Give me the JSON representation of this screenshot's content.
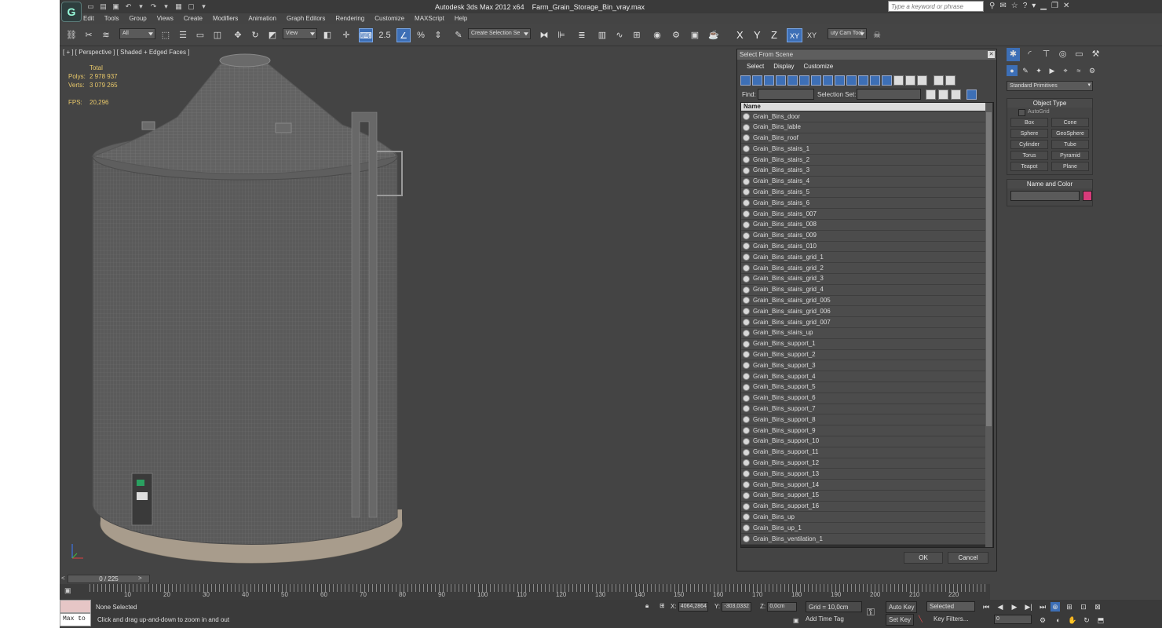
{
  "title": {
    "app": "Autodesk 3ds Max  2012 x64",
    "file": "Farm_Grain_Storage_Bin_vray.max",
    "search_placeholder": "Type a keyword or phrase"
  },
  "menu": [
    "Edit",
    "Tools",
    "Group",
    "Views",
    "Create",
    "Modifiers",
    "Animation",
    "Graph Editors",
    "Rendering",
    "Customize",
    "MAXScript",
    "Help"
  ],
  "toolbar": {
    "filter": "All",
    "refcoord": "View",
    "snap_angle": "2.5",
    "selset": "Create Selection Se",
    "axes": [
      "X",
      "Y",
      "Z",
      "XY",
      "XY"
    ],
    "camtool": "uty Cam Tool"
  },
  "viewport": {
    "label": "[ + ] [ Perspective ] [ Shaded + Edged Faces ]",
    "stats": {
      "total_label": "Total",
      "polys_label": "Polys:",
      "polys": "2 978 937",
      "verts_label": "Verts:",
      "verts": "3 079 265",
      "fps_label": "FPS:",
      "fps": "20,296"
    }
  },
  "sfs": {
    "title": "Select From Scene",
    "menu": [
      "Select",
      "Display",
      "Customize"
    ],
    "find_label": "Find:",
    "selset_label": "Selection Set:",
    "column": "Name",
    "items": [
      "Grain_Bins_door",
      "Grain_Bins_lable",
      "Grain_Bins_roof",
      "Grain_Bins_stairs_1",
      "Grain_Bins_stairs_2",
      "Grain_Bins_stairs_3",
      "Grain_Bins_stairs_4",
      "Grain_Bins_stairs_5",
      "Grain_Bins_stairs_6",
      "Grain_Bins_stairs_007",
      "Grain_Bins_stairs_008",
      "Grain_Bins_stairs_009",
      "Grain_Bins_stairs_010",
      "Grain_Bins_stairs_grid_1",
      "Grain_Bins_stairs_grid_2",
      "Grain_Bins_stairs_grid_3",
      "Grain_Bins_stairs_grid_4",
      "Grain_Bins_stairs_grid_005",
      "Grain_Bins_stairs_grid_006",
      "Grain_Bins_stairs_grid_007",
      "Grain_Bins_stairs_up",
      "Grain_Bins_support_1",
      "Grain_Bins_support_2",
      "Grain_Bins_support_3",
      "Grain_Bins_support_4",
      "Grain_Bins_support_5",
      "Grain_Bins_support_6",
      "Grain_Bins_support_7",
      "Grain_Bins_support_8",
      "Grain_Bins_support_9",
      "Grain_Bins_support_10",
      "Grain_Bins_support_11",
      "Grain_Bins_support_12",
      "Grain_Bins_support_13",
      "Grain_Bins_support_14",
      "Grain_Bins_support_15",
      "Grain_Bins_support_16",
      "Grain_Bins_up",
      "Grain_Bins_up_1",
      "Grain_Bins_ventilation_1"
    ],
    "ok": "OK",
    "cancel": "Cancel"
  },
  "cmd": {
    "category": "Standard Primitives",
    "object_type": "Object Type",
    "autogrid": "AutoGrid",
    "primitives": [
      "Box",
      "Cone",
      "Sphere",
      "GeoSphere",
      "Cylinder",
      "Tube",
      "Torus",
      "Pyramid",
      "Teapot",
      "Plane"
    ],
    "name_color": "Name and Color",
    "swatch_color": "#d63b7a"
  },
  "timeline": {
    "slider": "0 / 225",
    "ticks": [
      "10",
      "20",
      "30",
      "40",
      "50",
      "60",
      "70",
      "80",
      "90",
      "100",
      "110",
      "120",
      "130",
      "140",
      "150",
      "160",
      "170",
      "180",
      "190",
      "200",
      "210",
      "220"
    ]
  },
  "status": {
    "maxscript": "Max to",
    "selection": "None Selected",
    "hint": "Click and drag up-and-down to zoom in and out",
    "x_label": "X:",
    "x": "4064,2864",
    "y_label": "Y:",
    "y": "-303,0332",
    "z_label": "Z:",
    "z": "0,0cm",
    "grid": "Grid = 10,0cm",
    "add_time_tag": "Add Time Tag",
    "auto_key": "Auto Key",
    "set_key": "Set Key",
    "selected": "Selected",
    "key_filters": "Key Filters...",
    "frame": "0"
  }
}
